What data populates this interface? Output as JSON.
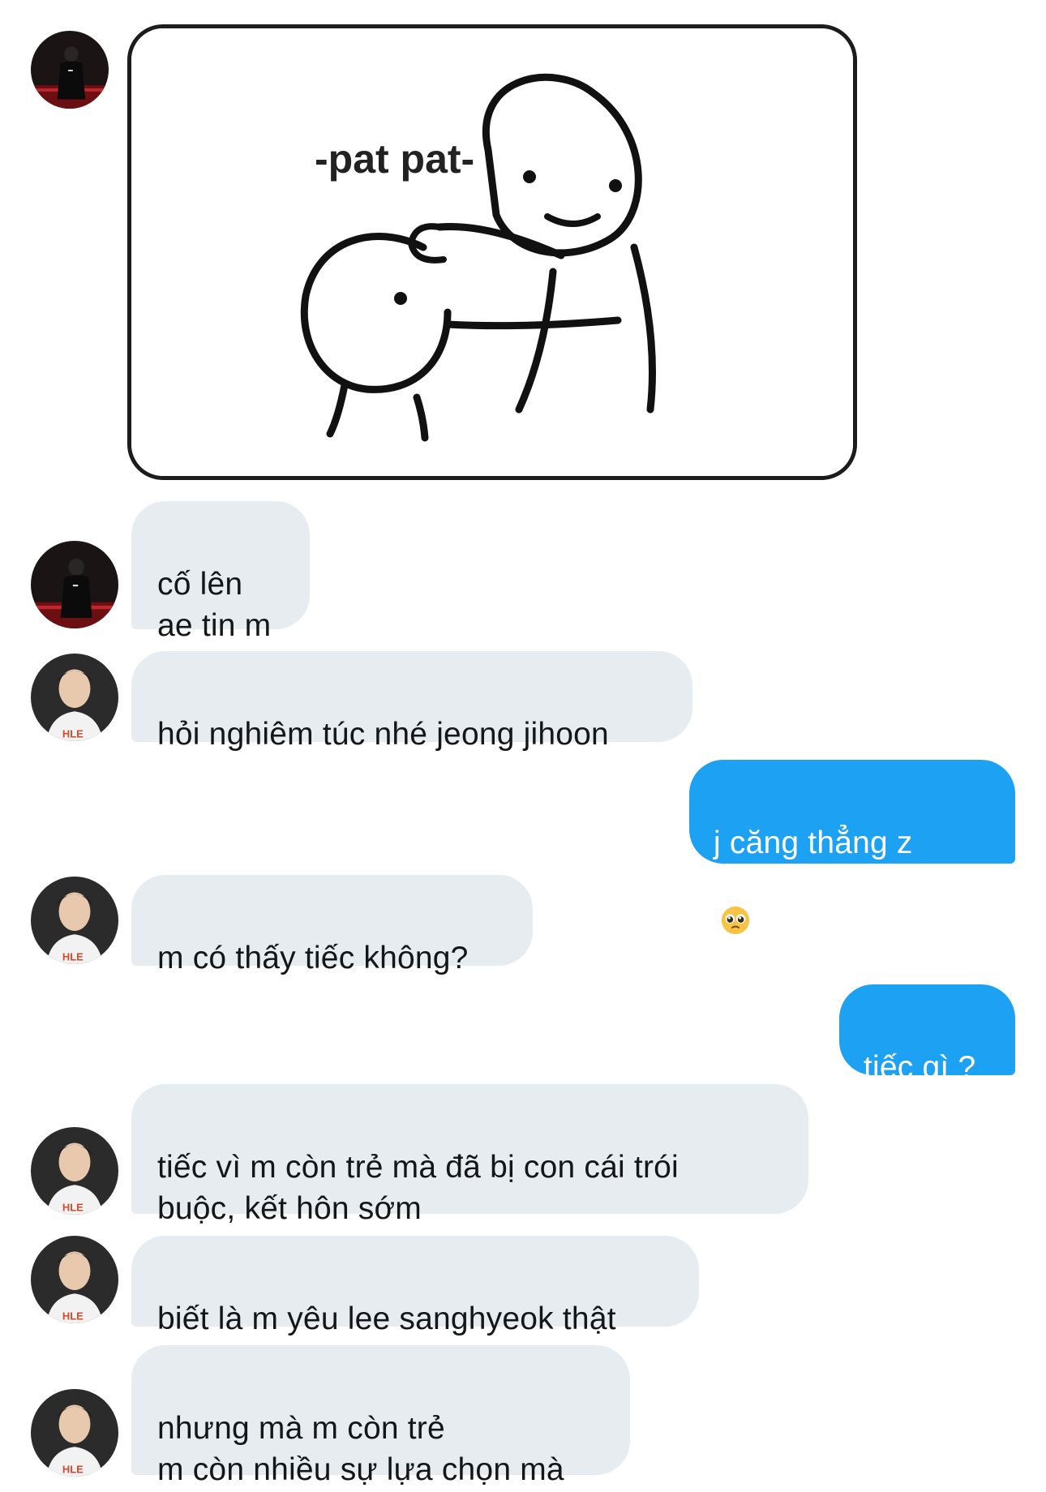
{
  "conversation": {
    "image_message": {
      "caption": "-pat pat-"
    },
    "messages": [
      {
        "direction": "incoming",
        "avatar": "avatar-black-outfit",
        "text": "cố lên\nae tin m"
      },
      {
        "direction": "incoming",
        "avatar": "avatar-hle-jersey",
        "text": "hỏi nghiêm túc nhé jeong jihoon"
      },
      {
        "direction": "outgoing",
        "text": "j căng thẳng z",
        "emoji": "pleading-face-icon"
      },
      {
        "direction": "incoming",
        "avatar": "avatar-hle-jersey",
        "text": "m có thấy tiếc không?"
      },
      {
        "direction": "outgoing",
        "text": "tiếc gì ?"
      },
      {
        "direction": "incoming",
        "avatar": "avatar-hle-jersey",
        "text": "tiếc vì m còn trẻ mà đã bị con cái trói\nbuộc, kết hôn sớm"
      },
      {
        "direction": "incoming",
        "avatar": "avatar-hle-jersey",
        "text": "biết là m yêu lee sanghyeok thật"
      },
      {
        "direction": "incoming",
        "avatar": "avatar-hle-jersey",
        "text": "nhưng mà m còn trẻ\nm còn nhiều sự lựa chọn mà"
      }
    ],
    "avatar_badge_text": "HLE"
  },
  "colors": {
    "incoming_bubble": "#e6ecf0",
    "outgoing_bubble": "#1da1f2",
    "text_dark": "#14171a",
    "text_light": "#ffffff"
  }
}
